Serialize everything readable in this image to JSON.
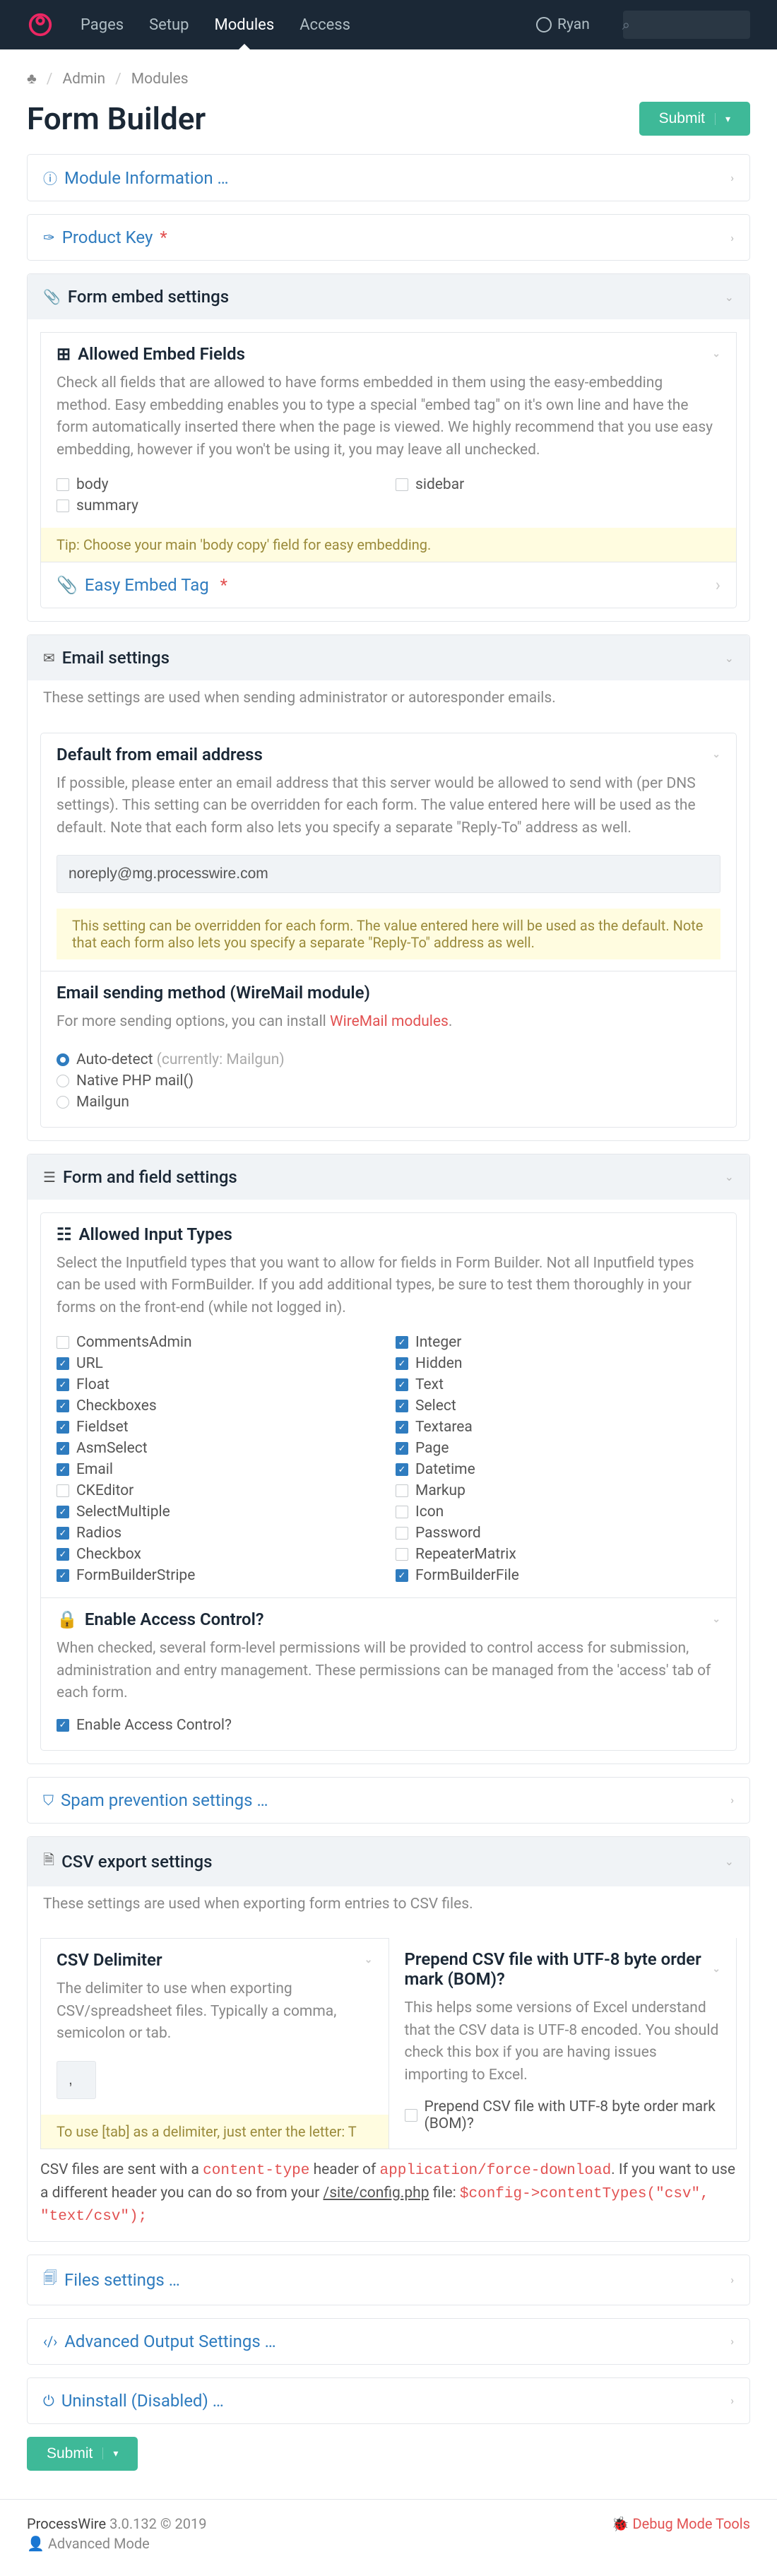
{
  "nav": {
    "items": [
      "Pages",
      "Setup",
      "Modules",
      "Access"
    ],
    "active": "Modules",
    "user": "Ryan"
  },
  "breadcrumb": {
    "items": [
      "Admin",
      "Modules"
    ]
  },
  "page": {
    "title": "Form Builder",
    "submit": "Submit"
  },
  "moduleInfo": {
    "label": "Module Information …"
  },
  "productKey": {
    "label": "Product Key"
  },
  "embed": {
    "header": "Form embed settings",
    "allowed": {
      "title": "Allowed Embed Fields",
      "help": "Check all fields that are allowed to have forms embedded in them using the easy-embedding method. Easy embedding enables you to type a special \"embed tag\" on it's own line and have the form automatically inserted there when the page is viewed. We highly recommend that you use easy embedding, however if you won't be using it, you may leave all unchecked.",
      "left": [
        "body",
        "summary"
      ],
      "right": [
        "sidebar"
      ],
      "tip": "Tip: Choose your main 'body copy' field for easy embedding."
    },
    "easyTag": "Easy Embed Tag"
  },
  "email": {
    "header": "Email settings",
    "help": "These settings are used when sending administrator or autoresponder emails.",
    "from": {
      "title": "Default from email address",
      "help": "If possible, please enter an email address that this server would be allowed to send with (per DNS settings). This setting can be overridden for each form. The value entered here will be used as the default. Note that each form also lets you specify a separate \"Reply-To\" address as well.",
      "value": "noreply@mg.processwire.com",
      "note": "This setting can be overridden for each form. The value entered here will be used as the default. Note that each form also lets you specify a separate \"Reply-To\" address as well."
    },
    "method": {
      "title": "Email sending method (WireMail module)",
      "help_pre": "For more sending options, you can install ",
      "help_link": "WireMail modules",
      "options": [
        {
          "label_pre": "Auto-detect ",
          "label_dim": "(currently: Mailgun)",
          "checked": true
        },
        {
          "label": "Native PHP mail()",
          "checked": false
        },
        {
          "label": "Mailgun",
          "checked": false
        }
      ]
    }
  },
  "fields": {
    "header": "Form and field settings",
    "allowed": {
      "title": "Allowed Input Types",
      "help": "Select the Inputfield types that you want to allow for fields in Form Builder. Not all Inputfield types can be used with FormBuilder. If you add additional types, be sure to test them thoroughly in your forms on the front-end (while not logged in).",
      "left": [
        {
          "l": "CommentsAdmin",
          "c": false
        },
        {
          "l": "URL",
          "c": true
        },
        {
          "l": "Float",
          "c": true
        },
        {
          "l": "Checkboxes",
          "c": true
        },
        {
          "l": "Fieldset",
          "c": true
        },
        {
          "l": "AsmSelect",
          "c": true
        },
        {
          "l": "Email",
          "c": true
        },
        {
          "l": "CKEditor",
          "c": false
        },
        {
          "l": "SelectMultiple",
          "c": true
        },
        {
          "l": "Radios",
          "c": true
        },
        {
          "l": "Checkbox",
          "c": true
        },
        {
          "l": "FormBuilderStripe",
          "c": true
        }
      ],
      "right": [
        {
          "l": "Integer",
          "c": true
        },
        {
          "l": "Hidden",
          "c": true
        },
        {
          "l": "Text",
          "c": true
        },
        {
          "l": "Select",
          "c": true
        },
        {
          "l": "Textarea",
          "c": true
        },
        {
          "l": "Page",
          "c": true
        },
        {
          "l": "Datetime",
          "c": true
        },
        {
          "l": "Markup",
          "c": false
        },
        {
          "l": "Icon",
          "c": false
        },
        {
          "l": "Password",
          "c": false
        },
        {
          "l": "RepeaterMatrix",
          "c": false
        },
        {
          "l": "FormBuilderFile",
          "c": true
        }
      ]
    },
    "access": {
      "title": "Enable Access Control?",
      "help": "When checked, several form-level permissions will be provided to control access for submission, administration and entry management. These permissions can be managed from the 'access' tab of each form.",
      "chk": "Enable Access Control?"
    }
  },
  "spam": {
    "label": "Spam prevention settings …"
  },
  "csv": {
    "header": "CSV export settings",
    "help": "These settings are used when exporting form entries to CSV files.",
    "delim": {
      "title": "CSV Delimiter",
      "help": "The delimiter to use when exporting CSV/spreadsheet files. Typically a comma, semicolon or tab.",
      "value": ",",
      "tip": "To use [tab] as a delimiter, just enter the letter: T"
    },
    "bom": {
      "title": "Prepend CSV file with UTF-8 byte order mark (BOM)?",
      "help": "This helps some versions of Excel understand that the CSV data is UTF-8 encoded. You should check this box if you are having issues importing to Excel.",
      "chk": "Prepend CSV file with UTF-8 byte order mark (BOM)?"
    },
    "note1": "CSV files are sent with a ",
    "note_code1": "content-type",
    "note2": " header of ",
    "note_code2": "application/force-download",
    "note3": ". If you want to use a different header you can do so from your ",
    "note_path": "/site/config.php",
    "note4": " file: ",
    "note_code3": "$config->contentTypes(\"csv\", \"text/csv\");"
  },
  "files": {
    "label": "Files settings …"
  },
  "advanced": {
    "label": "Advanced Output Settings …"
  },
  "uninstall": {
    "label": "Uninstall (Disabled) …"
  },
  "footer": {
    "pw": "ProcessWire",
    "ver": "3.0.132 © 2019",
    "adv": "Advanced Mode",
    "debug": "Debug Mode Tools"
  }
}
